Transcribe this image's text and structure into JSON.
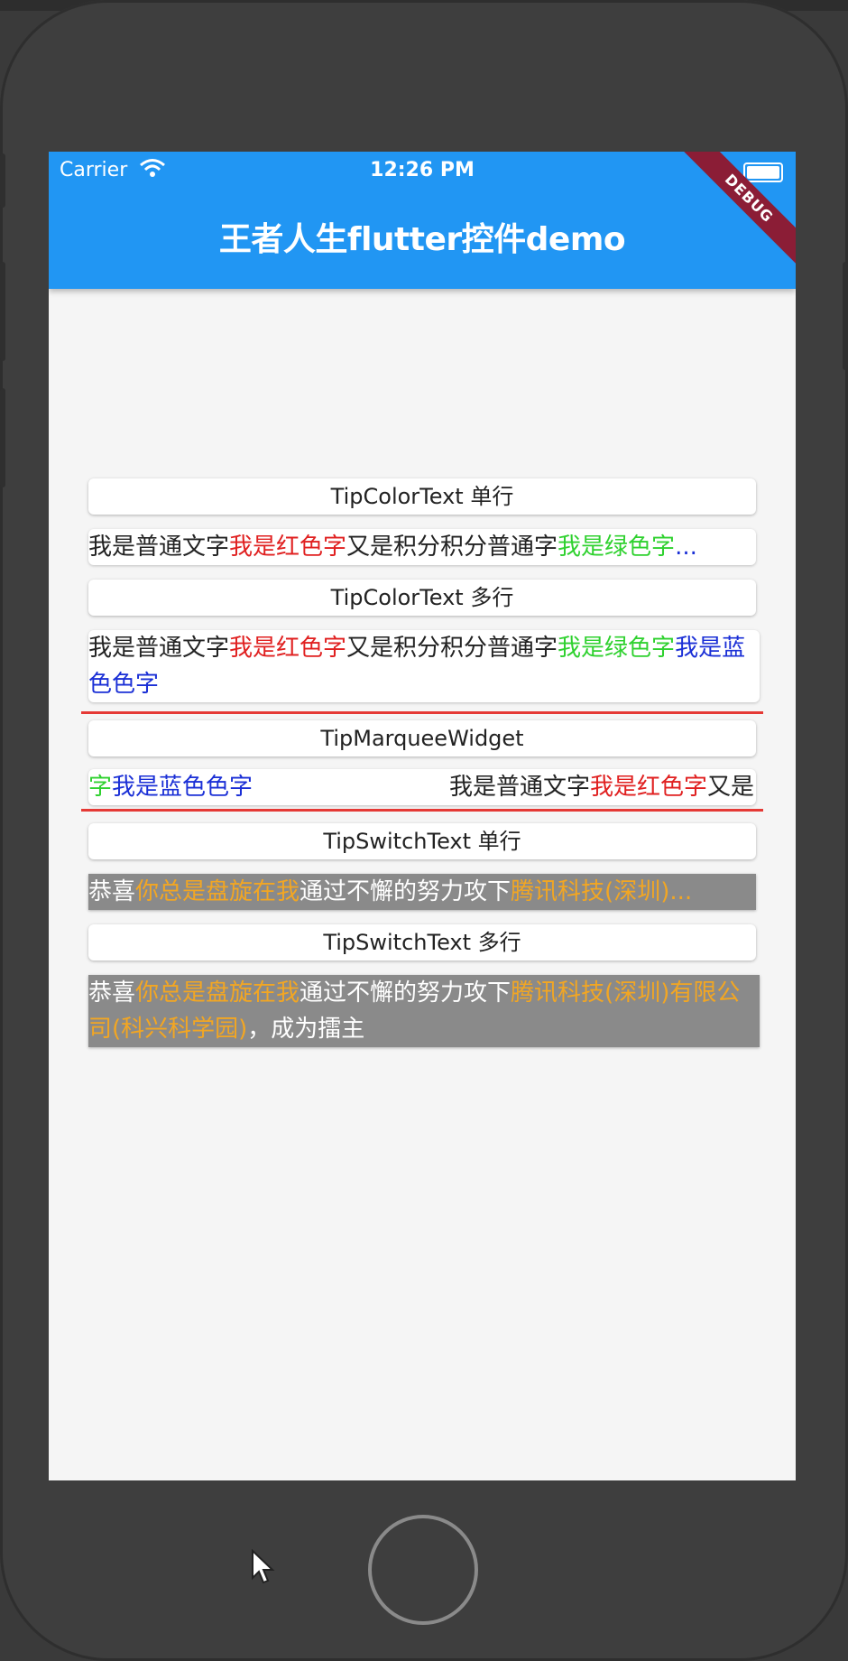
{
  "status_bar": {
    "carrier": "Carrier",
    "time": "12:26 PM"
  },
  "app_bar": {
    "title": "王者人生flutter控件demo",
    "debug_banner": "DEBUG"
  },
  "colors": {
    "app_bar": "#2196f3",
    "red": "#e02020",
    "green": "#2fd12f",
    "blue": "#1a2fd6",
    "orange": "#f2a623",
    "divider": "#e53935"
  },
  "sections": {
    "tip_color_single": {
      "button": "TipColorText 单行",
      "segments": [
        "我是普通文字",
        "我是红色字",
        "又是积分积分普通字",
        "我是绿色字",
        "..."
      ]
    },
    "tip_color_multi": {
      "button": "TipColorText 多行",
      "segments": [
        "我是普通文字",
        "我是红色字",
        "又是积分积分普通字",
        "我是绿色字",
        "我是蓝色色字"
      ]
    },
    "marquee": {
      "button": "TipMarqueeWidget",
      "left_segments": [
        "字",
        "我是蓝色色字"
      ],
      "right_segments": [
        "我是普通文字",
        "我是红色字",
        "又是"
      ]
    },
    "switch_single": {
      "button": "TipSwitchText 单行",
      "segments": [
        "恭喜",
        "你总是盘旋在我",
        "通过不懈的努力攻下",
        "腾讯科技(深圳)..."
      ]
    },
    "switch_multi": {
      "button": "TipSwitchText 多行",
      "segments": [
        "恭喜",
        "你总是盘旋在我",
        "通过不懈的努力攻下",
        "腾讯科技(深圳)有限公司(科兴科学园)",
        "，成为擂主"
      ]
    }
  }
}
